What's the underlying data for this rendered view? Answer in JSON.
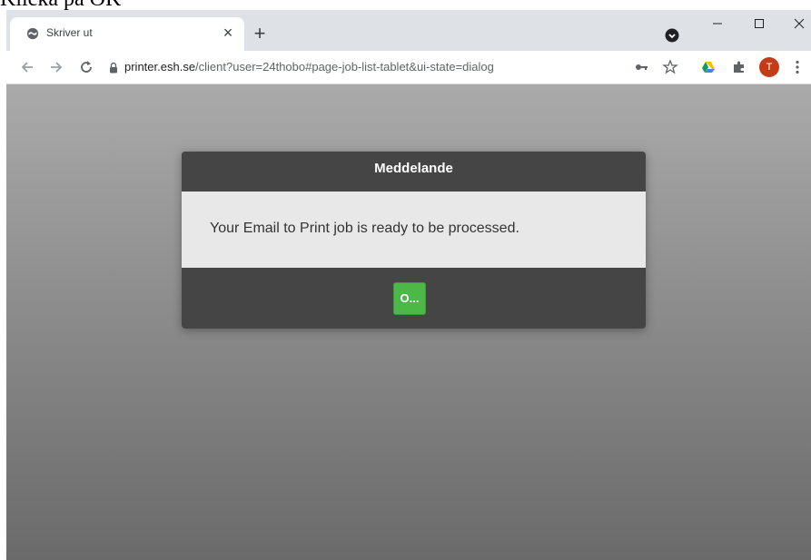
{
  "caption": "Klicka på OK",
  "browser": {
    "tab": {
      "title": "Skriver ut",
      "close_glyph": "×",
      "favicon": "globe-icon"
    },
    "new_tab_glyph": "+",
    "window_controls": {
      "minimize": "–",
      "maximize": "☐",
      "close": "✕"
    },
    "address": {
      "host": "printer.esh.se",
      "path": "/client?user=24thobo#page-job-list-tablet&ui-state=dialog"
    },
    "avatar_letter": "T"
  },
  "dialog": {
    "title": "Meddelande",
    "message": "Your Email to Print job is ready to be processed.",
    "ok_label": "O..."
  },
  "colors": {
    "dialog_bg": "#454545",
    "dialog_body": "#e8e8e8",
    "ok_button": "#4cb848",
    "avatar": "#c53b16"
  }
}
